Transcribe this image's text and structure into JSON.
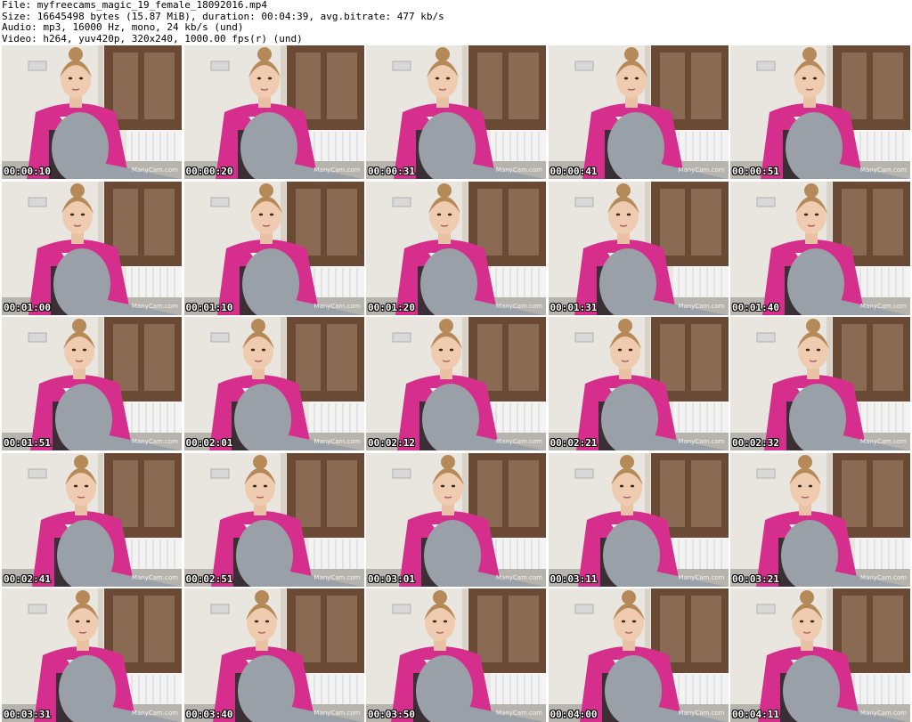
{
  "header": {
    "file_line": "File: myfreecams_magic_19_female_18092016.mp4",
    "size_line": "Size: 16645498 bytes (15.87 MiB), duration: 00:04:39, avg.bitrate: 477 kb/s",
    "audio_line": "Audio: mp3, 16000 Hz, mono, 24 kb/s (und)",
    "video_line": "Video: h264, yuv420p, 320x240, 1000.00 fps(r) (und)"
  },
  "watermark_text": "ManyCam.com",
  "colors": {
    "jacket": "#d62e8c",
    "leggings": "#9aa0a8",
    "wall": "#e9e6e0",
    "door": "#6b4a35",
    "radiator": "#f3f3f3"
  },
  "thumbnails": [
    {
      "timestamp": "00:00:10"
    },
    {
      "timestamp": "00:00:20"
    },
    {
      "timestamp": "00:00:31"
    },
    {
      "timestamp": "00:00:41"
    },
    {
      "timestamp": "00:00:51"
    },
    {
      "timestamp": "00:01:00"
    },
    {
      "timestamp": "00:01:10"
    },
    {
      "timestamp": "00:01:20"
    },
    {
      "timestamp": "00:01:31"
    },
    {
      "timestamp": "00:01:40"
    },
    {
      "timestamp": "00:01:51"
    },
    {
      "timestamp": "00:02:01"
    },
    {
      "timestamp": "00:02:12"
    },
    {
      "timestamp": "00:02:21"
    },
    {
      "timestamp": "00:02:32"
    },
    {
      "timestamp": "00:02:41"
    },
    {
      "timestamp": "00:02:51"
    },
    {
      "timestamp": "00:03:01"
    },
    {
      "timestamp": "00:03:11"
    },
    {
      "timestamp": "00:03:21"
    },
    {
      "timestamp": "00:03:31"
    },
    {
      "timestamp": "00:03:40"
    },
    {
      "timestamp": "00:03:50"
    },
    {
      "timestamp": "00:04:00"
    },
    {
      "timestamp": "00:04:11"
    }
  ]
}
